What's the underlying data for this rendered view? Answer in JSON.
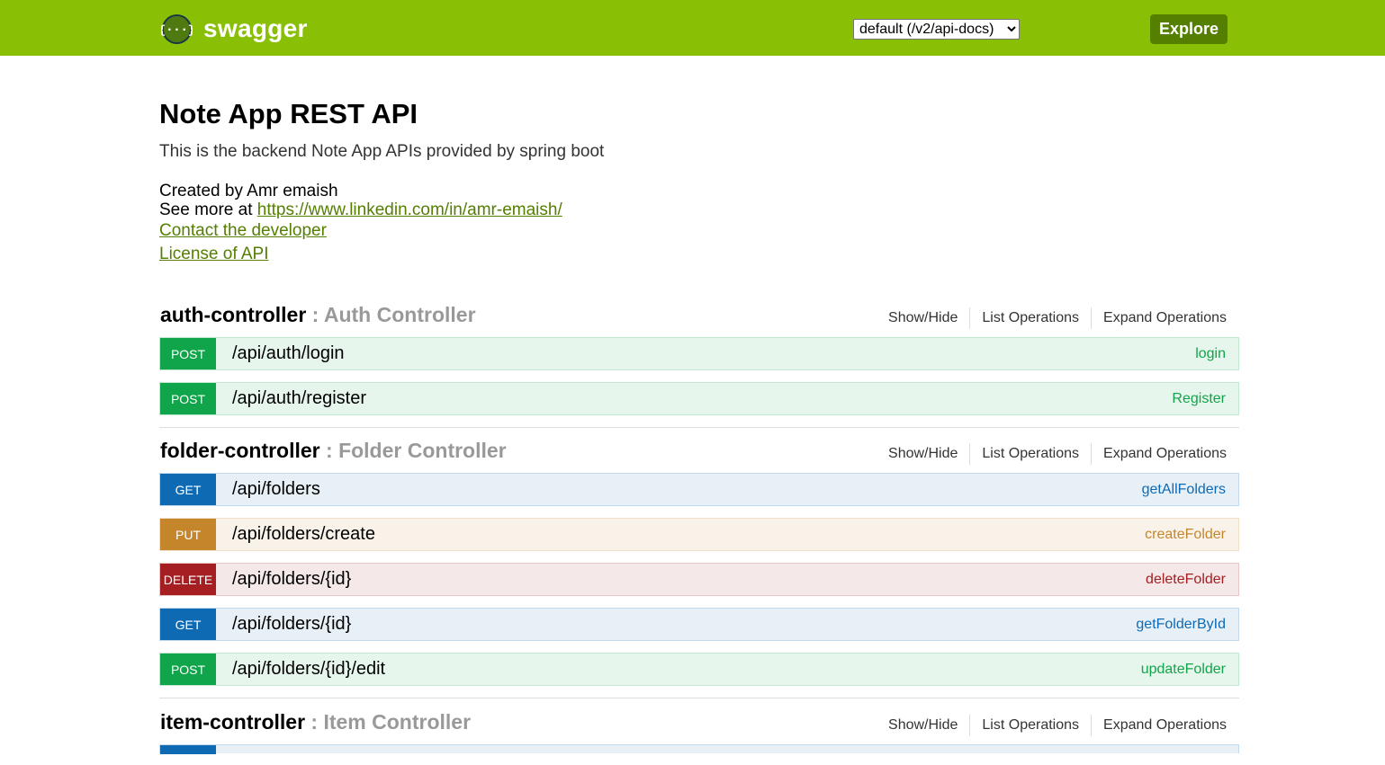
{
  "header": {
    "logo_text": "swagger",
    "api_select": {
      "selected": "default (/v2/api-docs)"
    },
    "explore_label": "Explore"
  },
  "info": {
    "title": "Note App REST API",
    "description": "This is the backend Note App APIs provided by spring boot",
    "created_by": "Created by Amr emaish",
    "see_more_prefix": "See more at ",
    "see_more_link": "https://www.linkedin.com/in/amr-emaish/",
    "contact_link": "Contact the developer",
    "license_link": "License of API"
  },
  "resource_options": {
    "show_hide": "Show/Hide",
    "list_operations": "List Operations",
    "expand_operations": "Expand Operations"
  },
  "resources": [
    {
      "name": "auth-controller",
      "description": ": Auth Controller",
      "operations": [
        {
          "method": "POST",
          "path": "/api/auth/login",
          "nickname": "login"
        },
        {
          "method": "POST",
          "path": "/api/auth/register",
          "nickname": "Register"
        }
      ]
    },
    {
      "name": "folder-controller",
      "description": ": Folder Controller",
      "operations": [
        {
          "method": "GET",
          "path": "/api/folders",
          "nickname": "getAllFolders"
        },
        {
          "method": "PUT",
          "path": "/api/folders/create",
          "nickname": "createFolder"
        },
        {
          "method": "DELETE",
          "path": "/api/folders/{id}",
          "nickname": "deleteFolder"
        },
        {
          "method": "GET",
          "path": "/api/folders/{id}",
          "nickname": "getFolderById"
        },
        {
          "method": "POST",
          "path": "/api/folders/{id}/edit",
          "nickname": "updateFolder"
        }
      ]
    },
    {
      "name": "item-controller",
      "description": ": Item Controller",
      "operations": []
    }
  ],
  "colors": {
    "header_bg": "#89bf04",
    "explore_bg": "#547f00",
    "post": "#10a54a",
    "get": "#0f6ab4",
    "put": "#c5862b",
    "delete": "#a41e22",
    "link": "#547f00"
  }
}
